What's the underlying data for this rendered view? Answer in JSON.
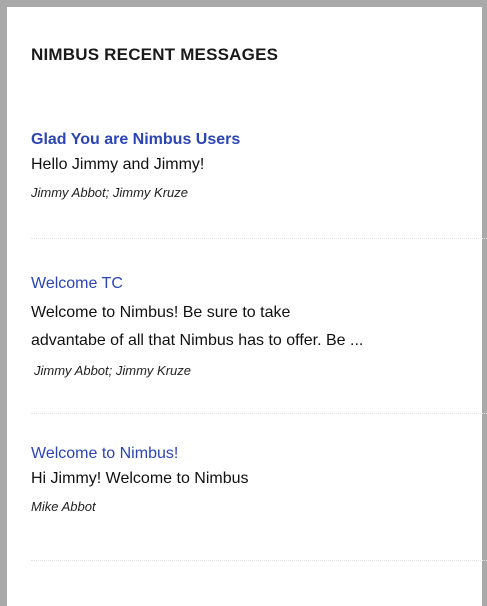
{
  "panel": {
    "title": "NIMBUS RECENT MESSAGES"
  },
  "messages": [
    {
      "subject": "Glad You are Nimbus Users",
      "body": "Hello Jimmy and Jimmy!",
      "recipients": "Jimmy Abbot; Jimmy Kruze"
    },
    {
      "subject": "Welcome TC",
      "body_line1": "Welcome to Nimbus! Be sure to take",
      "body_line2": "advantabe of all that Nimbus has to offer. Be ...",
      "recipients": "Jimmy Abbot; Jimmy Kruze"
    },
    {
      "subject": "Welcome to Nimbus!",
      "body": "Hi Jimmy! Welcome to Nimbus",
      "recipients": "Mike Abbot"
    }
  ],
  "colors": {
    "link": "#2b45b5",
    "frame": "#a9a9a9",
    "text": "#111111"
  }
}
